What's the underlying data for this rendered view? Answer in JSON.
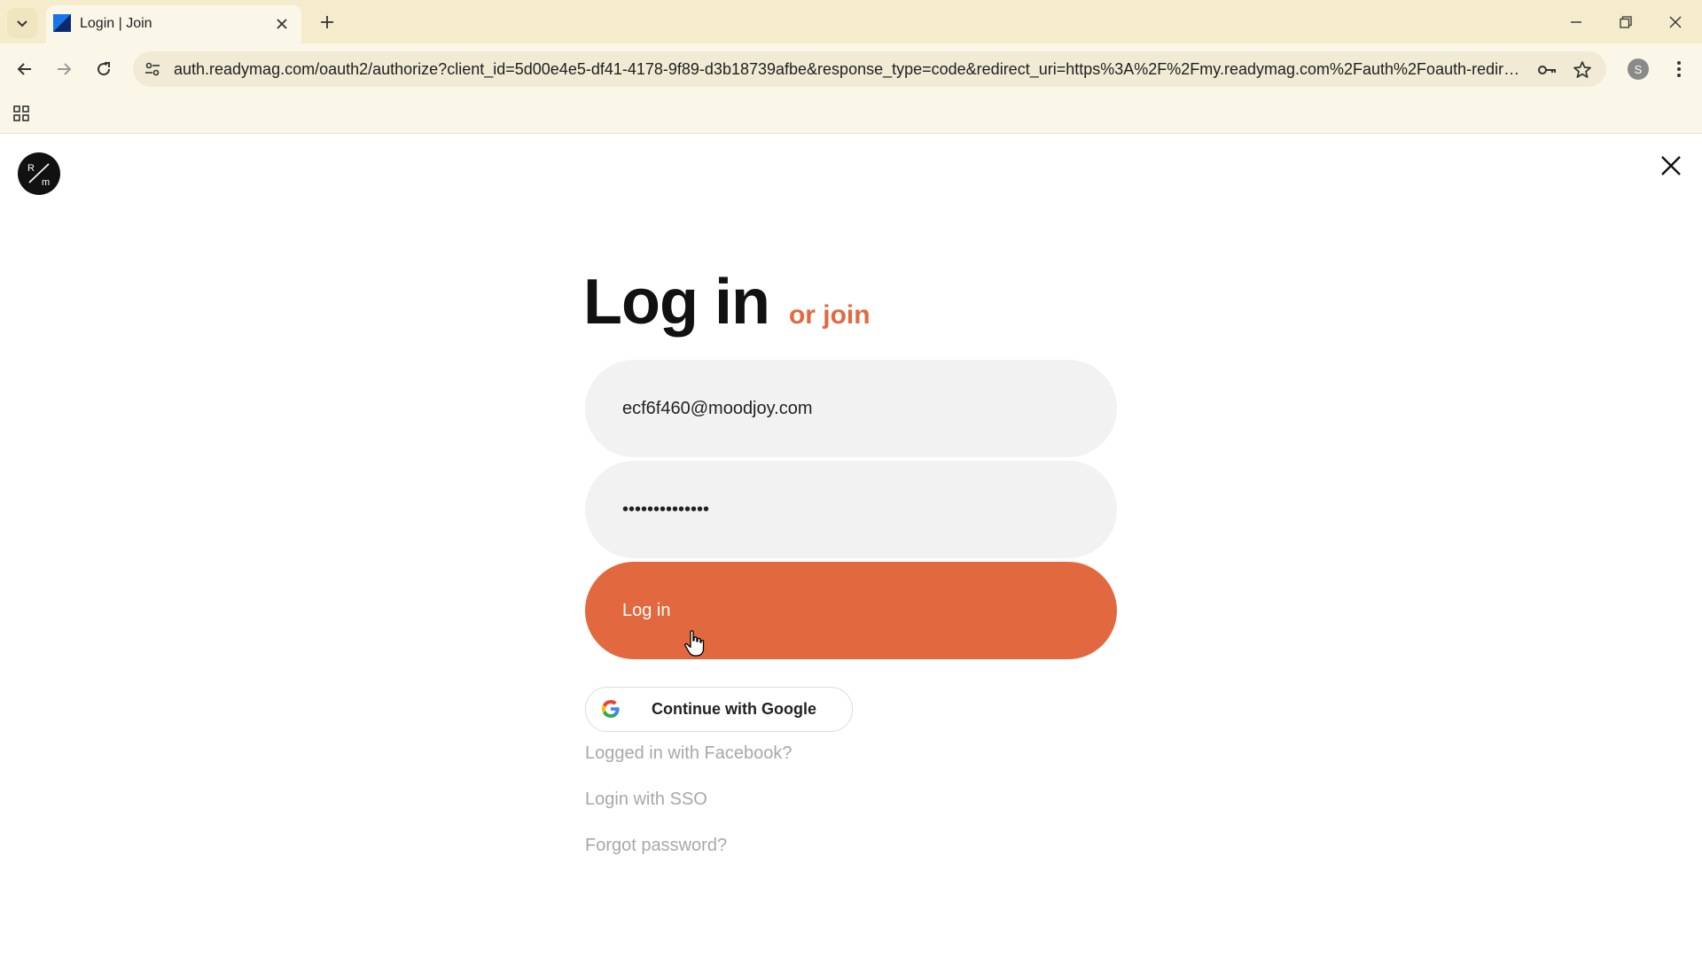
{
  "browser": {
    "tab_title": "Login | Join",
    "url": "auth.readymag.com/oauth2/authorize?client_id=5d00e4e5-df41-4178-9f89-d3b18739afbe&response_type=code&redirect_uri=https%3A%2F%2Fmy.readymag.com%2Fauth%2Foauth-redirect&sc...",
    "profile_initial": "S"
  },
  "page": {
    "title": "Log in",
    "join_link": "or join",
    "email_value": "ecf6f460@moodjoy.com",
    "password_value": "••••••••••••••",
    "login_button": "Log in",
    "google_button": "Continue with Google",
    "facebook_link": "Logged in with Facebook?",
    "sso_link": "Login with SSO",
    "forgot_link": "Forgot password?"
  },
  "colors": {
    "accent": "#e2693f",
    "chrome_bg": "#f4eccb"
  }
}
